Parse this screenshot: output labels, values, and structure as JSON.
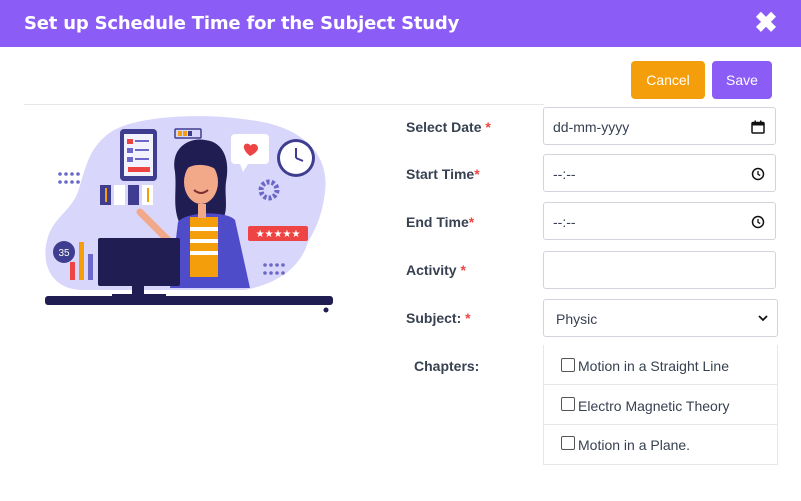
{
  "modal": {
    "title": "Set up Schedule Time for the Subject Study",
    "close_glyph": "✖"
  },
  "actions": {
    "cancel_label": "Cancel",
    "save_label": "Save"
  },
  "colors": {
    "primary": "#8b5cf6",
    "cancel": "#f59e0b",
    "required": "#ef4444"
  },
  "form": {
    "select_date": {
      "label": "Select Date ",
      "required": "*",
      "value": "dd-mm-yyyy",
      "icon": "calendar-icon"
    },
    "start_time": {
      "label": "Start Time",
      "required": "*",
      "value": "--:--",
      "icon": "clock-icon"
    },
    "end_time": {
      "label": "End Time",
      "required": "*",
      "value": "--:--",
      "icon": "clock-icon"
    },
    "activity": {
      "label": "Activity ",
      "required": "*",
      "value": ""
    },
    "subject": {
      "label": "Subject: ",
      "required": "*",
      "value": "Physic",
      "icon": "chevron-down-icon"
    },
    "chapters": {
      "label": "Chapters:",
      "items": [
        {
          "label": "Motion in a Straight Line",
          "checked": false
        },
        {
          "label": "Electro Magnetic Theory",
          "checked": false
        },
        {
          "label": "Motion in a Plane.",
          "checked": false
        }
      ]
    }
  },
  "illustration": {
    "chart_badge": "35",
    "form_button_text": "CONFIRM",
    "rating": "★★★★★"
  }
}
